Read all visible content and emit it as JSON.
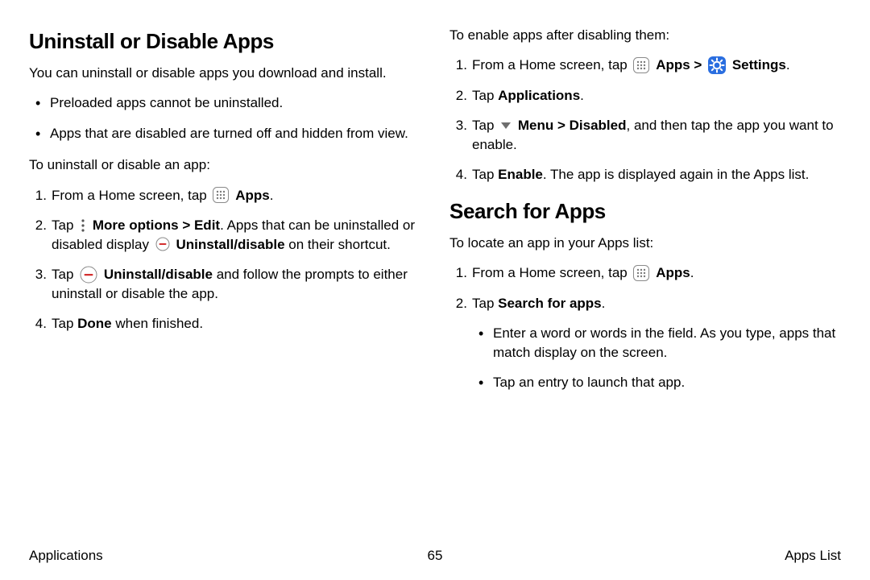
{
  "left": {
    "heading": "Uninstall or Disable Apps",
    "intro": "You can uninstall or disable apps you download and install.",
    "bullets": [
      "Preloaded apps cannot be uninstalled.",
      "Apps that are disabled are turned off and hidden from view."
    ],
    "uninstall_intro": "To uninstall or disable an app:",
    "step1_pre": "From a Home screen, tap ",
    "step1_apps": "Apps",
    "step1_post": ".",
    "step2_pre": "Tap ",
    "step2_more": "More options",
    "step2_sep": " > ",
    "step2_edit": "Edit",
    "step2_mid": ". Apps that can be uninstalled or disabled display ",
    "step2_ud": "Uninstall/disable",
    "step2_post": " on their shortcut.",
    "step3_pre": "Tap ",
    "step3_ud": "Uninstall/disable",
    "step3_post": " and follow the prompts to either uninstall or disable the app.",
    "step4_pre": "Tap ",
    "step4_done": "Done",
    "step4_post": " when finished."
  },
  "right": {
    "enable_intro": "To enable apps after disabling them:",
    "e1_pre": "From a Home screen, tap ",
    "e1_apps": "Apps",
    "e1_sep": " > ",
    "e1_settings": "Settings",
    "e1_post": ".",
    "e2_pre": "Tap ",
    "e2_apps": "Applications",
    "e2_post": ".",
    "e3_pre": "Tap ",
    "e3_menu": "Menu",
    "e3_sep": " > ",
    "e3_disabled": "Disabled",
    "e3_post": ", and then tap the app you want to enable.",
    "e4_pre": "Tap ",
    "e4_enable": "Enable",
    "e4_post": ". The app is displayed again in the Apps list.",
    "heading": "Search for Apps",
    "search_intro": "To locate an app in your Apps list:",
    "s1_pre": "From a Home screen, tap ",
    "s1_apps": "Apps",
    "s1_post": ".",
    "s2_pre": "Tap ",
    "s2_search": "Search for apps",
    "s2_post": ".",
    "sub1": "Enter a word or words in the field. As you type, apps that match display on the screen.",
    "sub2": "Tap an entry to launch that app."
  },
  "footer": {
    "left": "Applications",
    "center": "65",
    "right": "Apps List"
  }
}
